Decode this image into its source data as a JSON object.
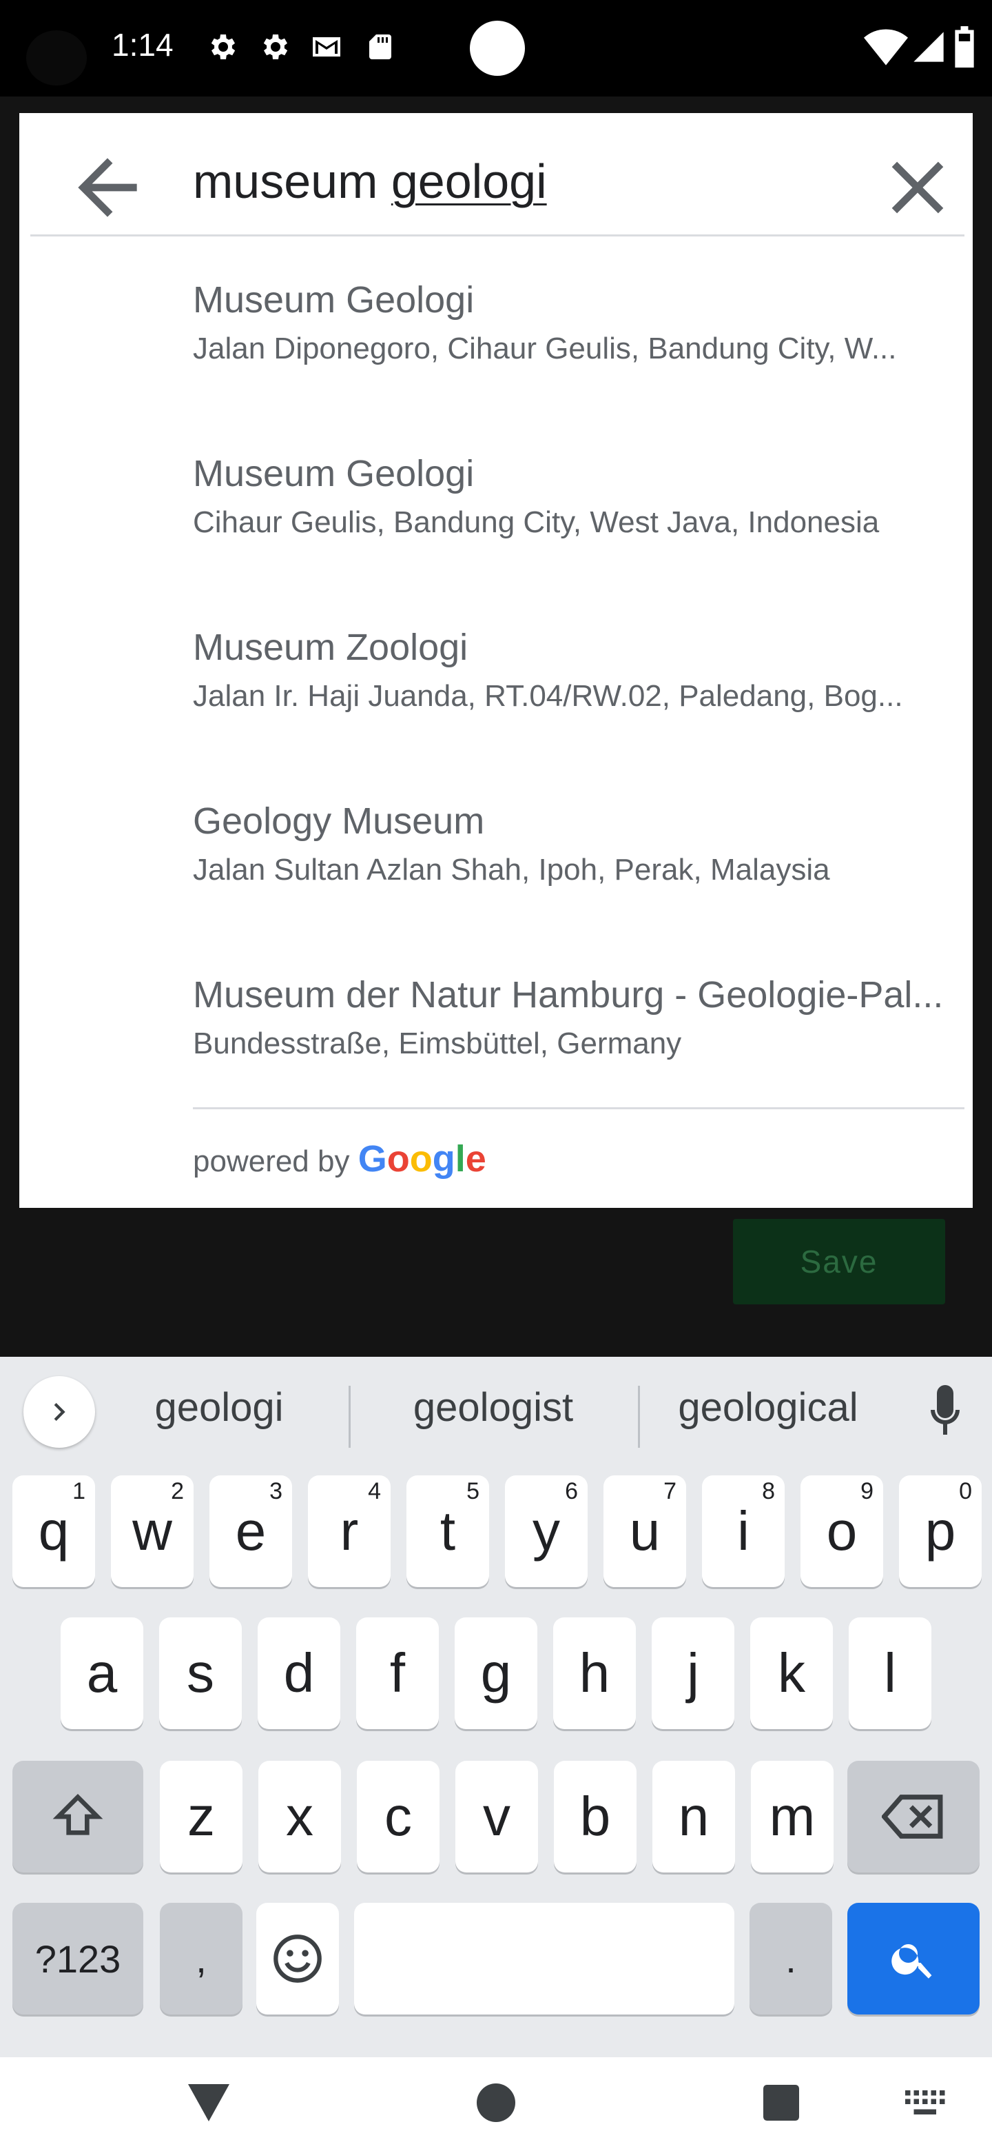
{
  "status_bar": {
    "time": "1:14"
  },
  "search": {
    "query_plain": "museum ",
    "query_underlined": "geologi",
    "results": [
      {
        "title": "Museum Geologi",
        "subtitle": "Jalan Diponegoro, Cihaur Geulis, Bandung City, W..."
      },
      {
        "title": "Museum Geologi",
        "subtitle": "Cihaur Geulis, Bandung City, West Java, Indonesia"
      },
      {
        "title": "Museum Zoologi",
        "subtitle": "Jalan Ir. Haji Juanda, RT.04/RW.02, Paledang, Bog..."
      },
      {
        "title": "Geology Museum",
        "subtitle": "Jalan Sultan Azlan Shah, Ipoh, Perak, Malaysia"
      },
      {
        "title": "Museum der Natur Hamburg - Geologie-Pal...",
        "subtitle": "Bundesstraße, Eimsbüttel, Germany"
      }
    ],
    "powered_by": "powered by",
    "google": [
      "G",
      "o",
      "o",
      "g",
      "l",
      "e"
    ]
  },
  "save_label": "Save",
  "keyboard": {
    "suggestions": [
      "geologi",
      "geologist",
      "geological"
    ],
    "row1": [
      "q",
      "w",
      "e",
      "r",
      "t",
      "y",
      "u",
      "i",
      "o",
      "p"
    ],
    "row1_hints": [
      "1",
      "2",
      "3",
      "4",
      "5",
      "6",
      "7",
      "8",
      "9",
      "0"
    ],
    "row2": [
      "a",
      "s",
      "d",
      "f",
      "g",
      "h",
      "j",
      "k",
      "l"
    ],
    "row3": [
      "z",
      "x",
      "c",
      "v",
      "b",
      "n",
      "m"
    ],
    "symbols_label": "?123",
    "comma": ",",
    "period": "."
  },
  "icons": {
    "back": "arrow-back-icon",
    "clear": "close-icon",
    "mic": "mic-icon",
    "shift": "shift-icon",
    "backspace": "backspace-icon",
    "emoji": "emoji-icon",
    "search": "search-icon"
  },
  "colors": {
    "accent": "#1a73e8",
    "save_bg": "#0c3118",
    "save_text": "#2c6a40"
  }
}
